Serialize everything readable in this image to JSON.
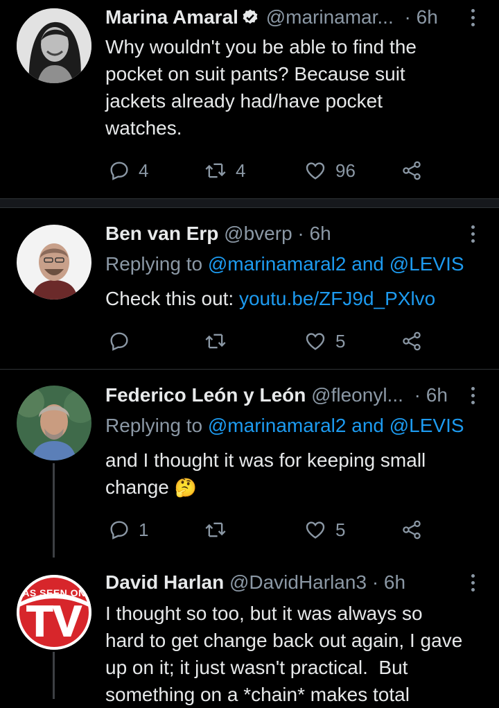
{
  "tweets": [
    {
      "name": "Marina Amaral",
      "handle": "@marinamar...",
      "time": "· 6h",
      "verified": true,
      "text": "Why wouldn't you be able to find the\npocket on suit pants? Because suit\njackets already had/have pocket\nwatches.",
      "replies": "4",
      "retweets": "4",
      "likes": "96"
    },
    {
      "name": "Ben van Erp",
      "handle": "@bverp",
      "time": "· 6h",
      "replying_prefix": "Replying to ",
      "replying_to": "@marinamaral2 and @LEVIS",
      "text_prefix": "Check this out: ",
      "link": "youtu.be/ZFJ9d_PXlvo",
      "replies": "",
      "retweets": "",
      "likes": "5"
    },
    {
      "name": "Federico León y León",
      "handle": "@fleonyl...",
      "time": "· 6h",
      "replying_prefix": "Replying to ",
      "replying_to": "@marinamaral2 and @LEVIS",
      "text": "and I thought it was for keeping small\nchange ",
      "emoji": "🤔",
      "replies": "1",
      "retweets": "",
      "likes": "5"
    },
    {
      "name": "David Harlan",
      "handle": "@DavidHarlan3",
      "time": "· 6h",
      "avatar_text_top": "AS SEEN ON",
      "avatar_text_main": "TV",
      "text": "I thought so too, but it was always so\nhard to get change back out again, I gave\nup on it; it just wasn't practical.  But\nsomething on a *chain* makes total"
    }
  ],
  "colors": {
    "background": "#000000",
    "text": "#e7e9ea",
    "secondary": "#8b98a5",
    "link": "#1d9bf0",
    "verified": "#e7e9ea",
    "tv_red": "#d7262b"
  },
  "icons": [
    "reply-icon",
    "retweet-icon",
    "like-icon",
    "share-icon",
    "more-icon",
    "verified-icon"
  ]
}
